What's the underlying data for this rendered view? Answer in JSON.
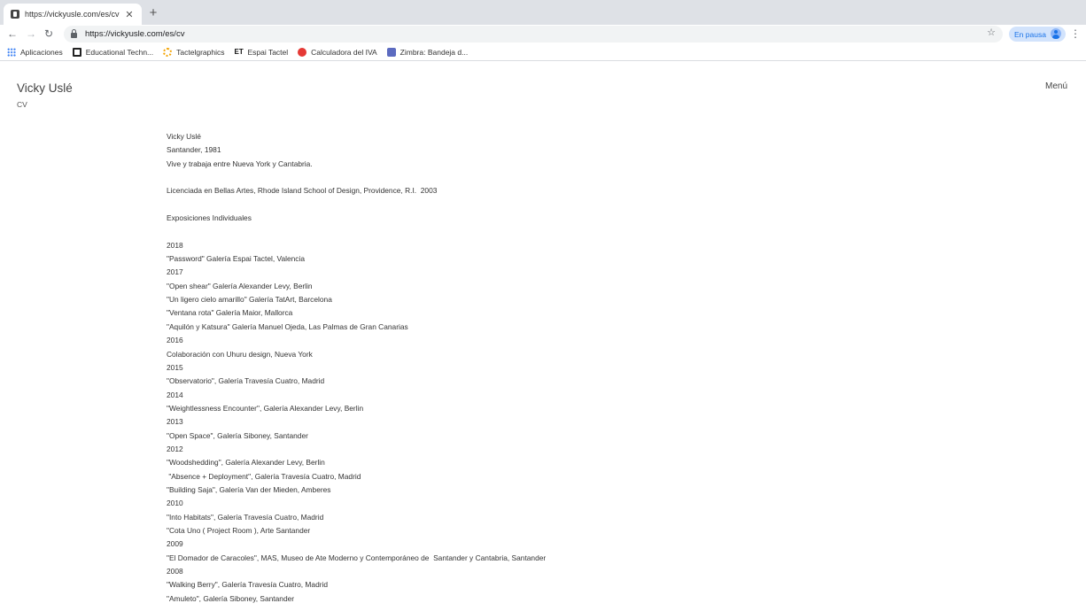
{
  "browser": {
    "tab": {
      "title": "https://vickyusle.com/es/cv"
    },
    "address": {
      "url": "https://vickyusle.com/es/cv"
    },
    "profile": {
      "status": "En pausa"
    },
    "bookmarks": [
      {
        "label": "Aplicaciones",
        "icon": "apps-grid-icon"
      },
      {
        "label": "Educational Techn...",
        "icon": "educational-tech-icon"
      },
      {
        "label": "Tactelgraphics",
        "icon": "tactelgraphics-icon"
      },
      {
        "label": "Espai Tactel",
        "icon": "espai-tactel-icon"
      },
      {
        "label": "Calculadora del IVA",
        "icon": "calculadora-iva-icon"
      },
      {
        "label": "Zimbra: Bandeja d...",
        "icon": "zimbra-icon"
      }
    ]
  },
  "site": {
    "title": "Vicky Uslé",
    "subtitle": "CV",
    "menu_label": "Menú"
  },
  "cv_lines": [
    "Vicky Uslé",
    "Santander, 1981",
    "Vive y trabaja entre Nueva York y Cantabria.",
    "",
    "Licenciada en Bellas Artes, Rhode Island School of Design, Providence, R.I.  2003",
    "",
    "Exposiciones Individuales",
    "",
    "2018",
    "\"Password\" Galería Espai Tactel, Valencia",
    "2017",
    "\"Open shear\" Galería Alexander Levy, Berlin",
    "\"Un ligero cielo amarillo\" Galería TatArt, Barcelona",
    "\"Ventana rota\" Galería Maior, Mallorca",
    "\"Aquilón y Katsura\" Galería Manuel Ojeda, Las Palmas de Gran Canarias",
    "2016",
    "Colaboración con Uhuru design, Nueva York",
    "2015",
    "\"Observatorio\", Galería Travesía Cuatro, Madrid",
    "2014",
    "\"Weightlessness Encounter\", Galería Alexander Levy, Berlin",
    "2013",
    "\"Open Space\", Galería Siboney, Santander",
    "2012",
    "\"Woodshedding\", Galería Alexander Levy, Berlin",
    " \"Absence + Deployment\", Galería Travesía Cuatro, Madrid",
    "\"Building Saja\", Galería Van der Mieden, Amberes",
    "2010",
    "\"Into Habitats\", Galería Travesía Cuatro, Madrid",
    "\"Cota Uno ( Project Room ), Arte Santander",
    "2009",
    "\"El Domador de Caracoles\", MAS, Museo de Ate Moderno y Contemporáneo de  Santander y Cantabria, Santander",
    "2008",
    "\"Walking Berry\", Galería Travesía Cuatro, Madrid",
    "\"Amuleto\", Galería Siboney, Santander"
  ]
}
